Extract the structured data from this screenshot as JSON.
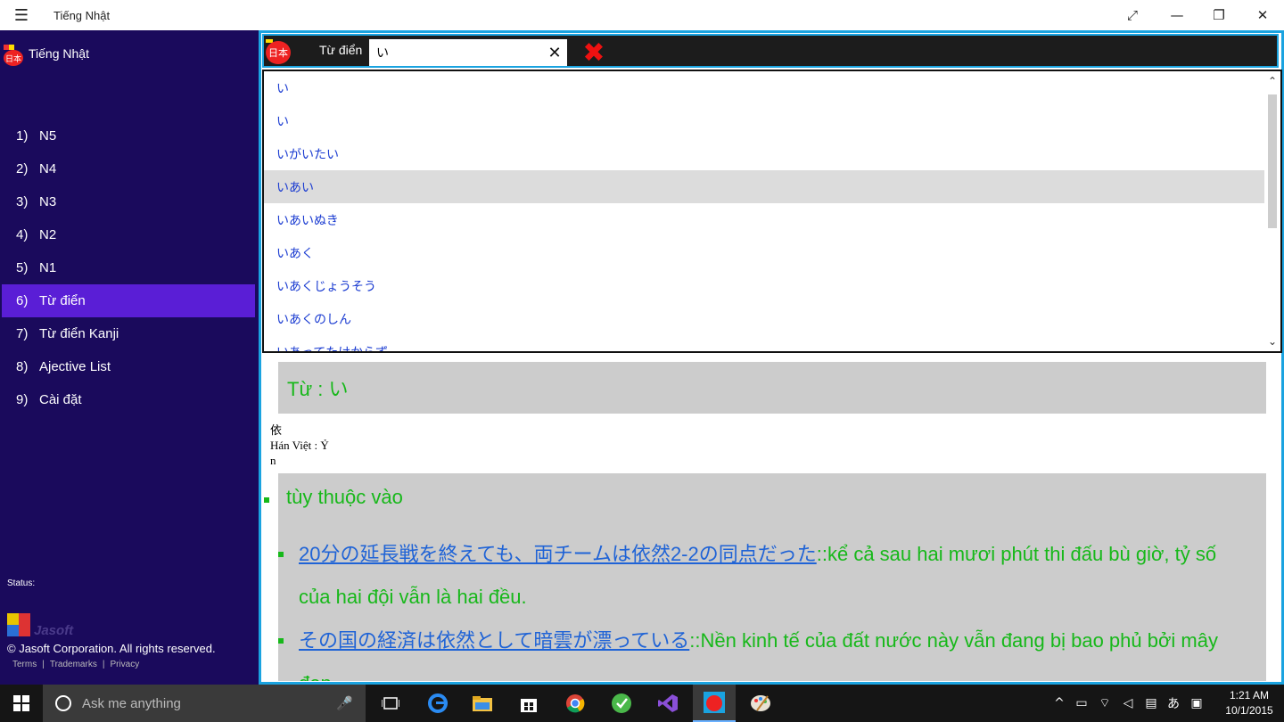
{
  "window": {
    "title": "Tiếng Nhật",
    "hamburger_icon": "☰",
    "maximize_icon": "⤢",
    "minimize_icon": "—",
    "restore_icon": "❐",
    "close_icon": "✕"
  },
  "sidebar": {
    "app_name": "Tiếng Nhật",
    "logo_text": "日本",
    "items": [
      {
        "num": "1)",
        "label": "N5"
      },
      {
        "num": "2)",
        "label": "N4"
      },
      {
        "num": "3)",
        "label": "N3"
      },
      {
        "num": "4)",
        "label": "N2"
      },
      {
        "num": "5)",
        "label": "N1"
      },
      {
        "num": "6)",
        "label": "Từ điển"
      },
      {
        "num": "7)",
        "label": "Từ điển Kanji"
      },
      {
        "num": "8)",
        "label": "Ajective List"
      },
      {
        "num": "9)",
        "label": "Cài đặt"
      }
    ],
    "active_index": 5,
    "status_label": "Status:",
    "company_logo_text": "Jasoft",
    "copyright": "© Jasoft Corporation. All rights reserved.",
    "links": [
      "Terms",
      "|",
      "Trademarks",
      "|",
      "Privacy"
    ]
  },
  "search": {
    "flag_text": "日本",
    "label": "Từ điển",
    "value": "い",
    "clear_icon": "✕",
    "close_icon": "✖"
  },
  "suggestions": {
    "items": [
      "い",
      "い",
      "いがいたい",
      "いあい",
      "いあいぬき",
      "いあく",
      "いあくじょうそう",
      "いあくのしん",
      "いあってたけからず"
    ],
    "highlighted_index": 3,
    "scroll_up_icon": "⌃",
    "scroll_down_icon": "⌄"
  },
  "entry": {
    "word_heading": "Từ : い",
    "kanji": "依",
    "han_viet": "Hán Việt : Ỷ",
    "pos": "n",
    "meaning": "tùy thuộc vào",
    "examples": [
      {
        "jp": "20分の延長戦を終えても、両チームは依然2-2の同点だった",
        "vi": "::kể cả sau hai mươi phút thi đấu bù giờ, tỷ số của hai đội vẫn là hai đều."
      },
      {
        "jp": "その国の経済は依然として暗雲が漂っている",
        "vi": "::Nền kinh tế của đất nước này vẫn đang bị bao phủ bởi mây đen."
      }
    ]
  },
  "taskbar": {
    "search_placeholder": "Ask me anything",
    "mic_icon": "🎤",
    "tray_text": "あ",
    "time": "1:21 AM",
    "date": "10/1/2015"
  }
}
